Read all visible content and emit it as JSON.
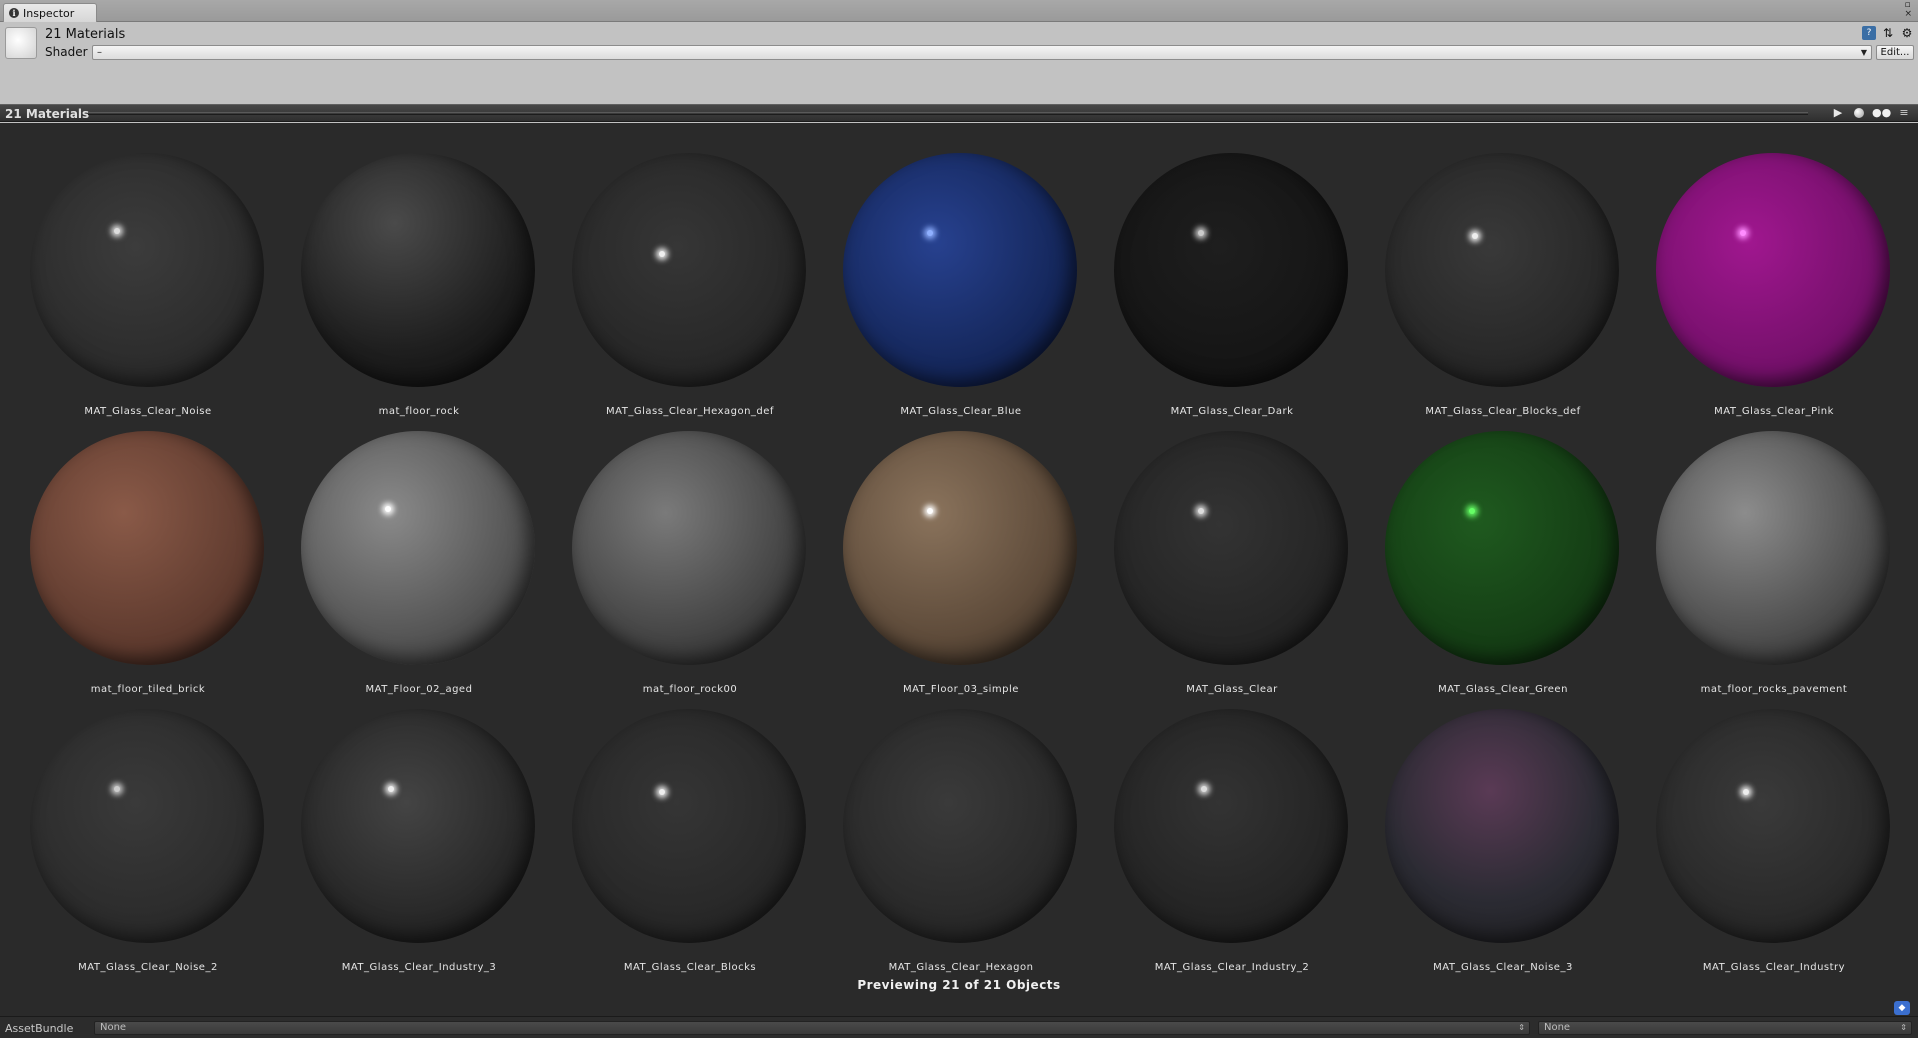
{
  "tab": {
    "label": "Inspector"
  },
  "header": {
    "title": "21 Materials",
    "shader_label": "Shader",
    "shader_value": "–",
    "edit_label": "Edit..."
  },
  "preview": {
    "title": "21 Materials",
    "status": "Previewing 21 of 21 Objects"
  },
  "materials": [
    {
      "name": "MAT_Glass_Clear_Noise"
    },
    {
      "name": "mat_floor_rock"
    },
    {
      "name": "MAT_Glass_Clear_Hexagon_def"
    },
    {
      "name": "MAT_Glass_Clear_Blue"
    },
    {
      "name": "MAT_Glass_Clear_Dark"
    },
    {
      "name": "MAT_Glass_Clear_Blocks_def"
    },
    {
      "name": "MAT_Glass_Clear_Pink"
    },
    {
      "name": "mat_floor_tiled_brick"
    },
    {
      "name": "MAT_Floor_02_aged"
    },
    {
      "name": "mat_floor_rock00"
    },
    {
      "name": "MAT_Floor_03_simple"
    },
    {
      "name": "MAT_Glass_Clear"
    },
    {
      "name": "MAT_Glass_Clear_Green"
    },
    {
      "name": "mat_floor_rocks_pavement"
    },
    {
      "name": "MAT_Glass_Clear_Noise_2"
    },
    {
      "name": "MAT_Glass_Clear_Industry_3"
    },
    {
      "name": "MAT_Glass_Clear_Blocks"
    },
    {
      "name": "MAT_Glass_Clear_Hexagon"
    },
    {
      "name": "MAT_Glass_Clear_Industry_2"
    },
    {
      "name": "MAT_Glass_Clear_Noise_3"
    },
    {
      "name": "MAT_Glass_Clear_Industry"
    }
  ],
  "assetbundle": {
    "label": "AssetBundle",
    "name_value": "None",
    "variant_value": "None"
  }
}
